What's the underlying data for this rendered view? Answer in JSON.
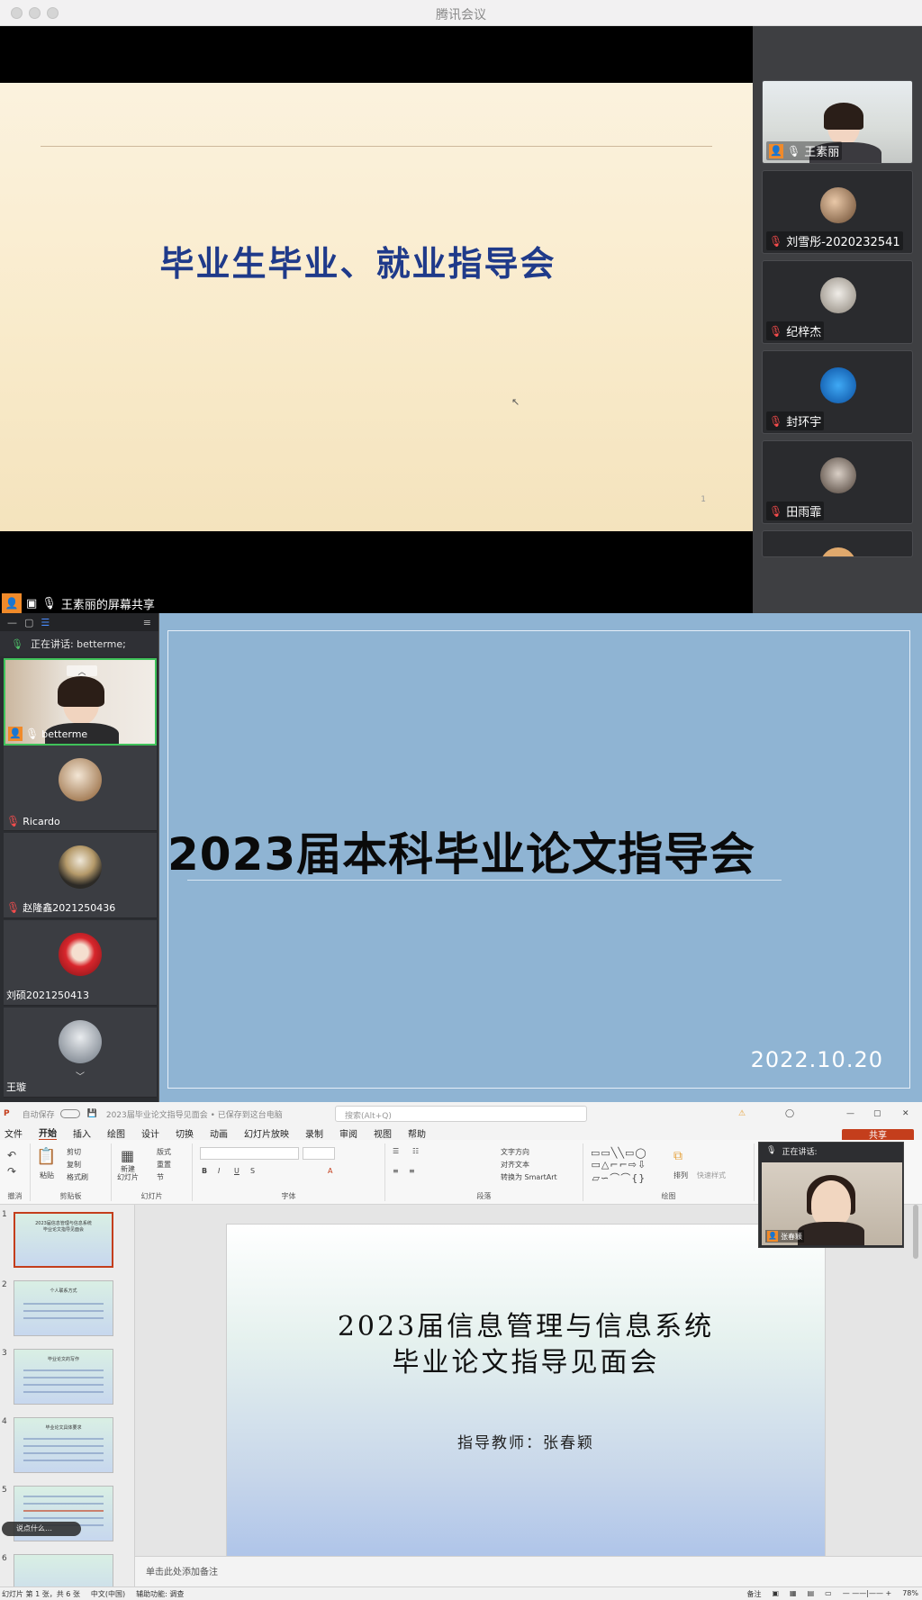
{
  "window": {
    "title": "腾讯会议"
  },
  "panel1": {
    "slide_title": "毕业生毕业、就业指导会",
    "page_number": "1",
    "share_label": "王素丽的屏幕共享",
    "participants": [
      {
        "name": "王素丽",
        "mic": "on",
        "host": true
      },
      {
        "name": "刘雪彤-2020232541",
        "mic": "off"
      },
      {
        "name": "纪梓杰",
        "mic": "off"
      },
      {
        "name": "封环宇",
        "mic": "off"
      },
      {
        "name": "田雨霏",
        "mic": "off"
      }
    ]
  },
  "panel2": {
    "speaking": "正在讲话: betterme;",
    "participants": [
      {
        "name": "betterme",
        "mic": "on",
        "host": true
      },
      {
        "name": "Ricardo",
        "mic": "off"
      },
      {
        "name": "赵隆鑫2021250436",
        "mic": "off"
      },
      {
        "name": "刘硕2021250413",
        "mic": "none"
      },
      {
        "name": "王璇",
        "mic": "none"
      }
    ],
    "slide_title": "2023届本科毕业论文指导会",
    "slide_date": "2022.10.20"
  },
  "panel3": {
    "doc_title": "2023届毕业论文指导见面会 • 已保存到这台电脑",
    "autosave": "自动保存",
    "search_placeholder": "搜索(Alt+Q)",
    "share_button": "共享",
    "menu": [
      "文件",
      "开始",
      "插入",
      "绘图",
      "设计",
      "切换",
      "动画",
      "幻灯片放映",
      "录制",
      "审阅",
      "视图",
      "帮助"
    ],
    "active_menu": "开始",
    "ribbon_groups": [
      "撤消",
      "剪贴板",
      "幻灯片",
      "字体",
      "段落",
      "绘图"
    ],
    "ribbon_buttons": {
      "paste": "粘贴",
      "cut": "剪切",
      "copy": "复制",
      "format_painter": "格式刷",
      "new_slide": "新建\n幻灯片",
      "layout": "版式",
      "reset": "重置",
      "section": "节",
      "text_direction": "文字方向",
      "align_text": "对齐文本",
      "smartart": "转换为 SmartArt",
      "arrange": "排列",
      "quick_styles": "快速样式"
    },
    "thumb_numbers": [
      "1",
      "2",
      "3",
      "4",
      "5",
      "6"
    ],
    "thumb_titles": [
      "2023届信息管理与信息系统\n毕业论文指导见面会",
      "个人联系方式",
      "毕业论文的写作",
      "毕业论文具体要求",
      "",
      ""
    ],
    "slide_line1": "2023届信息管理与信息系统",
    "slide_line2": "毕业论文指导见面会",
    "slide_line3": "指导教师：张春颖",
    "notes_placeholder": "单击此处添加备注",
    "status_slide": "幻灯片 第 1 张，共 6 张",
    "status_lang": "中文(中国)",
    "status_access": "辅助功能: 调查",
    "status_notes": "备注",
    "zoom": "78%",
    "pip_speaking": "正在讲话:",
    "pip_name": "张春颖",
    "float_label": "说点什么…"
  }
}
